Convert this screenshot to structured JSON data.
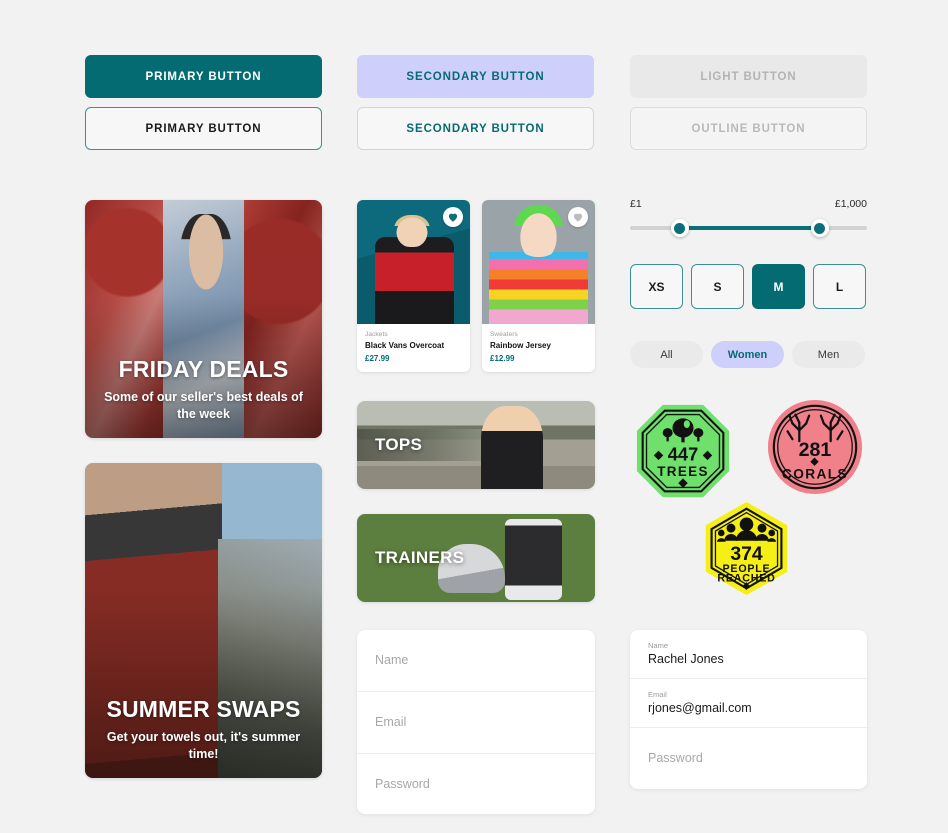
{
  "buttons": {
    "primary_solid": "PRIMARY BUTTON",
    "primary_outline": "PRIMARY BUTTON",
    "secondary_solid": "SECONDARY BUTTON",
    "secondary_outline": "SECONDARY BUTTON",
    "light": "LIGHT BUTTON",
    "outline": "OUTLINE BUTTON"
  },
  "heroes": [
    {
      "title": "FRIDAY DEALS",
      "subtitle": "Some of our seller's best deals of the week"
    },
    {
      "title": "SUMMER SWAPS",
      "subtitle": "Get your towels out, it's summer time!"
    }
  ],
  "products": [
    {
      "category": "Jackets",
      "name": "Black Vans Overcoat",
      "price": "£27.99",
      "favourite": true,
      "fav_icon": "heart-icon"
    },
    {
      "category": "Sweaters",
      "name": "Rainbow Jersey",
      "price": "£12.99",
      "favourite": false,
      "fav_icon": "heart-icon"
    }
  ],
  "categories": [
    {
      "label": "TOPS"
    },
    {
      "label": "TRAINERS"
    }
  ],
  "price_slider": {
    "min_label": "£1",
    "max_label": "£1,000",
    "lower_percent": 21,
    "upper_percent": 80,
    "accent": "#0B6E78"
  },
  "sizes": {
    "options": [
      "XS",
      "S",
      "M",
      "L"
    ],
    "selected": "M"
  },
  "segments": {
    "options": [
      "All",
      "Women",
      "Men"
    ],
    "selected": "Women"
  },
  "badges": [
    {
      "name": "trees-badge",
      "count": "447",
      "line1": "TREES",
      "line2": "",
      "color": "#6FE06B",
      "shape": "octagon",
      "icon": "tree-icon"
    },
    {
      "name": "corals-badge",
      "count": "281",
      "line1": "CORALS",
      "line2": "",
      "color": "#F0808A",
      "shape": "circle",
      "icon": "coral-icon"
    },
    {
      "name": "people-badge",
      "count": "374",
      "line1": "PEOPLE",
      "line2": "REACHED",
      "color": "#F5EF16",
      "shape": "hexagon",
      "icon": "people-icon"
    }
  ],
  "forms": {
    "empty_form": {
      "fields": [
        {
          "placeholder": "Name"
        },
        {
          "placeholder": "Email"
        },
        {
          "placeholder": "Password"
        }
      ]
    },
    "filled_form": {
      "fields": [
        {
          "label": "Name",
          "value": "Rachel Jones"
        },
        {
          "label": "Email",
          "value": "rjones@gmail.com"
        },
        {
          "placeholder": "Password"
        }
      ]
    }
  },
  "theme": {
    "page_bg": "#F2F2F2",
    "primary": "#056B72",
    "secondary": "#CFCFFB",
    "muted": "#B3B3B3"
  }
}
